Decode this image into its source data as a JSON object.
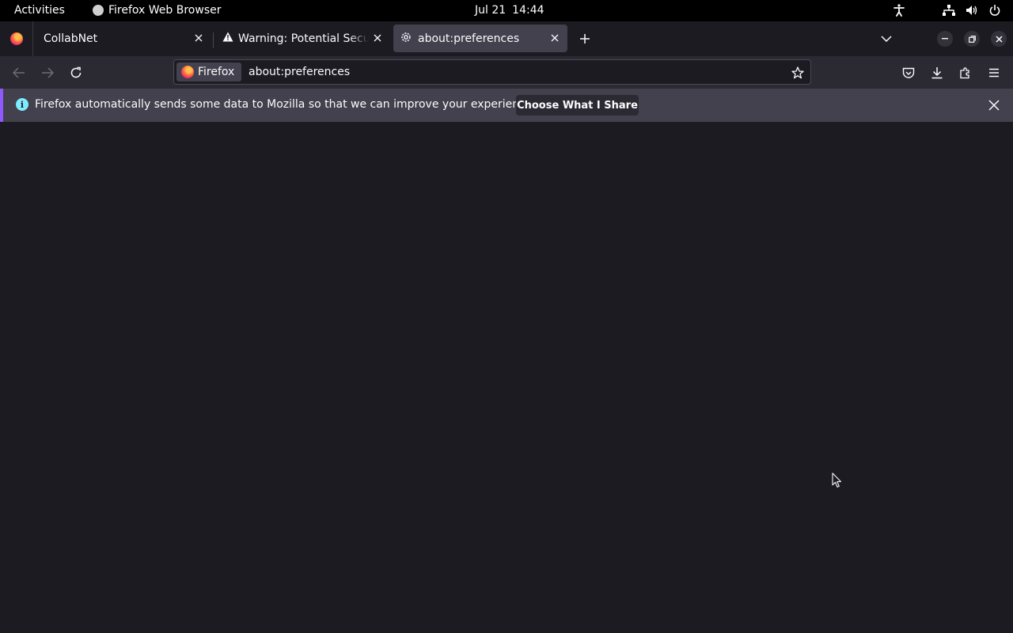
{
  "topbar": {
    "activities": "Activities",
    "app_name": "Firefox Web Browser",
    "date": "Jul 21",
    "time": "14:44",
    "tray_icons": [
      "accessibility-icon",
      "network-icon",
      "volume-icon",
      "power-icon"
    ]
  },
  "tabs": [
    {
      "label": "CollabNet",
      "icon": "none",
      "active": false
    },
    {
      "label": "Warning: Potential Security Risk Ahead",
      "icon": "warning-icon",
      "active": false
    },
    {
      "label": "about:preferences",
      "icon": "gear-icon",
      "active": true
    }
  ],
  "navbar": {
    "identity_label": "Firefox",
    "url": "about:preferences"
  },
  "notification": {
    "message": "Firefox automatically sends some data to Mozilla so that we can improve your experience.",
    "button_label": "Choose What I Share"
  },
  "colors": {
    "background": "#1c1b22",
    "toolbar": "#2b2a33",
    "active_tab": "#42414d",
    "notice_accent": "#9059ff",
    "info": "#80ebff"
  }
}
